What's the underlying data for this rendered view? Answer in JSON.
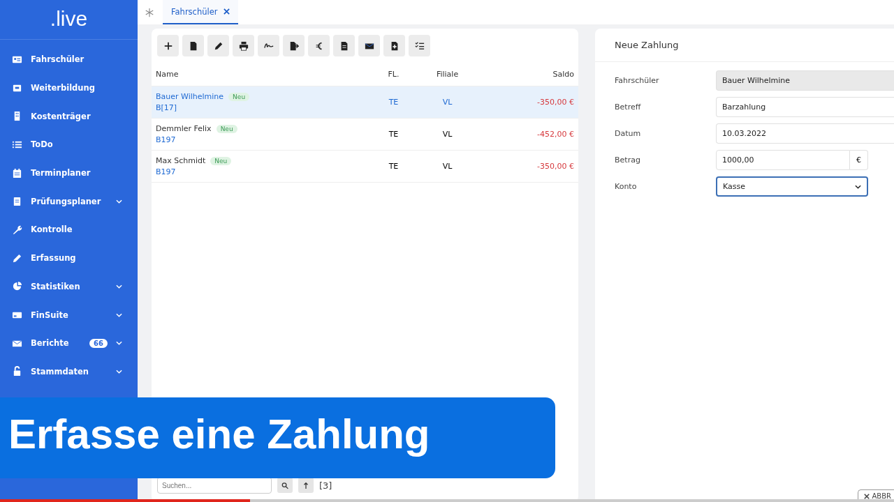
{
  "sidebar": {
    "logo": ".live",
    "items": [
      {
        "label": "Fahrschüler",
        "expandable": false
      },
      {
        "label": "Weiterbildung",
        "expandable": false
      },
      {
        "label": "Kostenträger",
        "expandable": false
      },
      {
        "label": "ToDo",
        "expandable": false
      },
      {
        "label": "Terminplaner",
        "expandable": false
      },
      {
        "label": "Prüfungsplaner",
        "expandable": true
      },
      {
        "label": "Kontrolle",
        "expandable": false
      },
      {
        "label": "Erfassung",
        "expandable": false
      },
      {
        "label": "Statistiken",
        "expandable": true
      },
      {
        "label": "FinSuite",
        "expandable": true
      },
      {
        "label": "Berichte",
        "expandable": true,
        "badge": "66"
      },
      {
        "label": "Stammdaten",
        "expandable": true
      }
    ]
  },
  "tabs": [
    {
      "label": "Fahrschüler",
      "selected": true
    }
  ],
  "table": {
    "columns": [
      "Name",
      "FL.",
      "Filiale",
      "Saldo"
    ],
    "rows": [
      {
        "name": "Bauer Wilhelmine",
        "badge": "Neu",
        "class": "B[17]",
        "fl": "TE",
        "filiale": "VL",
        "saldo": "-350,00 €",
        "selected": true
      },
      {
        "name": "Demmler Felix",
        "badge": "Neu",
        "class": "B197",
        "fl": "TE",
        "filiale": "VL",
        "saldo": "-452,00 €",
        "selected": false
      },
      {
        "name": "Max Schmidt",
        "badge": "Neu",
        "class": "B197",
        "fl": "TE",
        "filiale": "VL",
        "saldo": "-350,00 €",
        "selected": false
      }
    ]
  },
  "footer": {
    "search_placeholder": "Suchen...",
    "count": "[3]"
  },
  "form": {
    "title": "Neue Zahlung",
    "fields": [
      {
        "label": "Fahrschüler",
        "value": "Bauer Wilhelmine",
        "kind": "text",
        "disabled": true
      },
      {
        "label": "Betreff",
        "value": "Barzahlung",
        "kind": "text",
        "disabled": false
      },
      {
        "label": "Datum",
        "value": "10.03.2022",
        "kind": "text",
        "disabled": false
      },
      {
        "label": "Betrag",
        "value": "1000,00",
        "kind": "currency",
        "addon": "€",
        "disabled": false
      },
      {
        "label": "Konto",
        "value": "Kasse",
        "kind": "select",
        "disabled": false
      }
    ],
    "cancel_button": "ABBR"
  },
  "caption": "Erfasse eine Zahlung",
  "video_progress": {
    "level": 0.28
  }
}
